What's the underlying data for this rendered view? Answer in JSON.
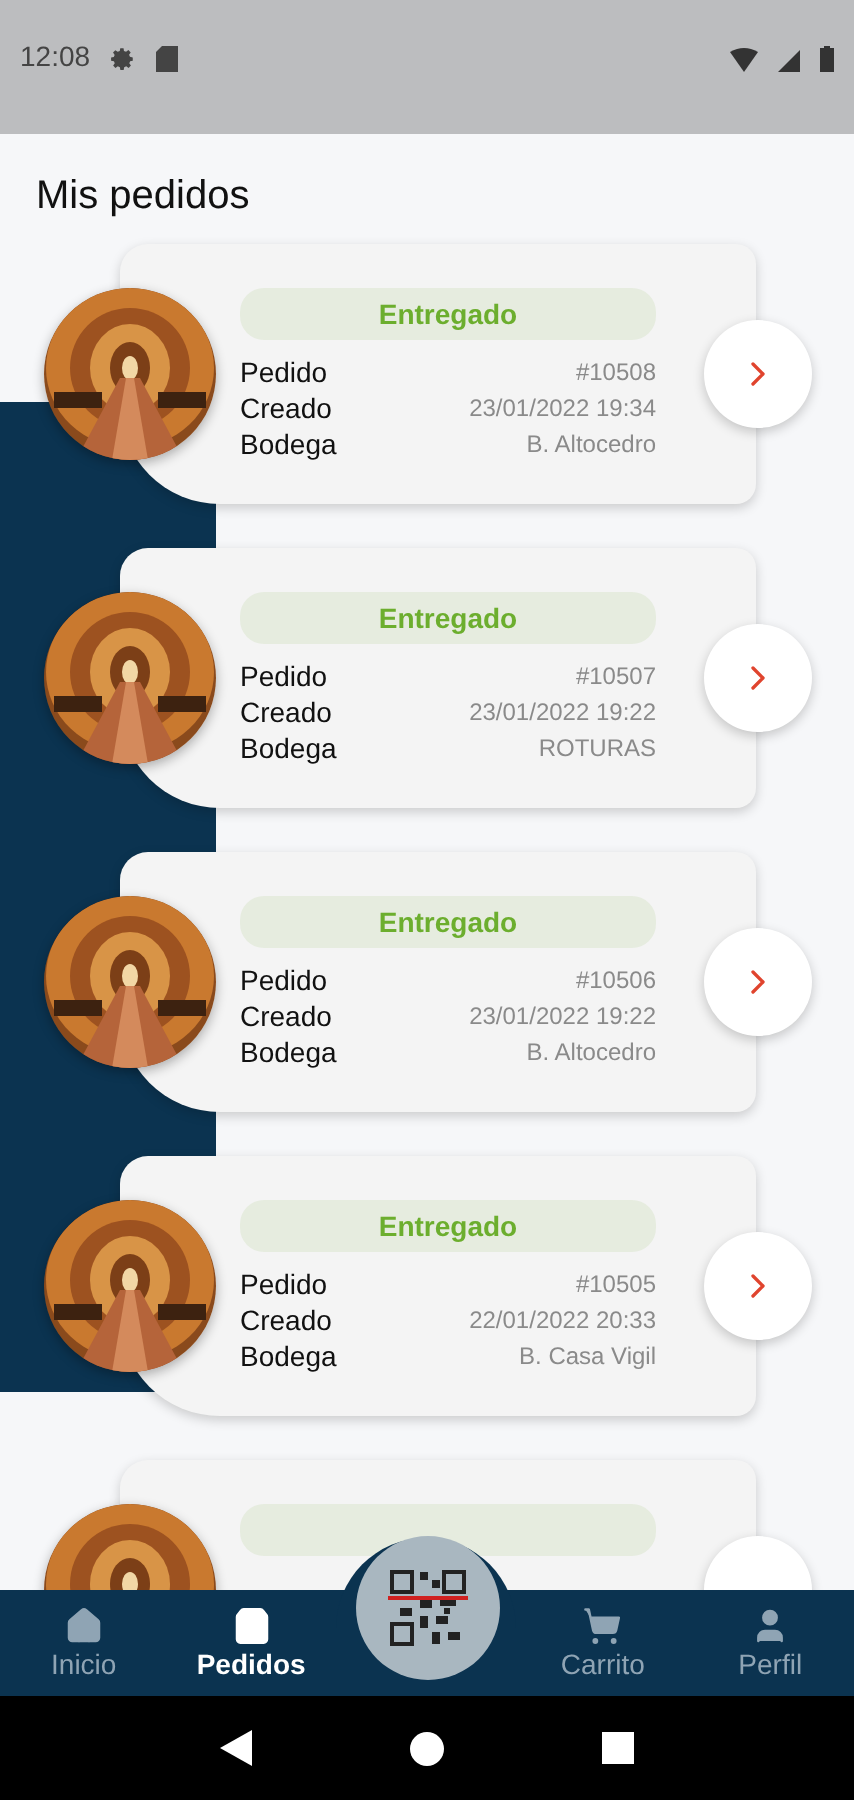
{
  "status_bar": {
    "time": "12:08"
  },
  "header": {
    "title": "Mis pedidos"
  },
  "orders": [
    {
      "kind": "full",
      "status": "Entregado",
      "fields": [
        {
          "label": "Pedido",
          "value": "#10508"
        },
        {
          "label": "Creado",
          "value": "23/01/2022 19:34"
        },
        {
          "label": "Bodega",
          "value": "B. Altocedro"
        }
      ]
    },
    {
      "kind": "full",
      "status": "Entregado",
      "fields": [
        {
          "label": "Pedido",
          "value": "#10507"
        },
        {
          "label": "Creado",
          "value": "23/01/2022 19:22"
        },
        {
          "label": "Bodega",
          "value": "ROTURAS"
        }
      ]
    },
    {
      "kind": "full",
      "status": "Entregado",
      "fields": [
        {
          "label": "Pedido",
          "value": "#10506"
        },
        {
          "label": "Creado",
          "value": "23/01/2022 19:22"
        },
        {
          "label": "Bodega",
          "value": "B. Altocedro"
        }
      ]
    },
    {
      "kind": "full",
      "status": "Entregado",
      "fields": [
        {
          "label": "Pedido",
          "value": "#10505"
        },
        {
          "label": "Creado",
          "value": "22/01/2022 20:33"
        },
        {
          "label": "Bodega",
          "value": "B. Casa Vigil"
        }
      ]
    },
    {
      "kind": "partial"
    }
  ],
  "bottom_nav": [
    {
      "label": "Inicio",
      "selected": false
    },
    {
      "label": "Pedidos",
      "selected": true
    },
    {
      "label": "Carrito",
      "selected": false
    },
    {
      "label": "Perfil",
      "selected": false
    }
  ]
}
